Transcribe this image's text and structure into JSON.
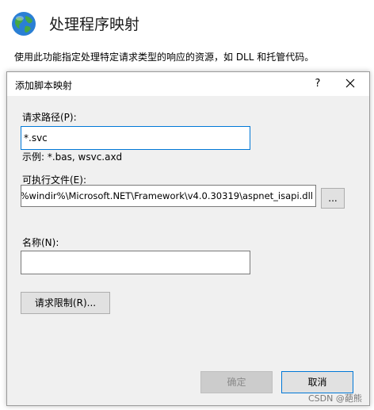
{
  "background": {
    "title": "处理程序映射",
    "description": "使用此功能指定处理特定请求类型的响应的资源，如 DLL 和托管代码。",
    "icon": "globe-icon"
  },
  "dialog": {
    "title": "添加脚本映射",
    "help_label": "?",
    "request_path": {
      "label": "请求路径(P):",
      "value": "*.svc",
      "example": "示例: *.bas, wsvc.axd"
    },
    "executable": {
      "label": "可执行文件(E):",
      "value": "%windir%\\Microsoft.NET\\Framework\\v4.0.30319\\aspnet_isapi.dll",
      "browse_label": "..."
    },
    "name": {
      "label": "名称(N):",
      "value": ""
    },
    "request_restrictions_label": "请求限制(R)...",
    "ok_label": "确定",
    "cancel_label": "取消"
  },
  "watermark": "CSDN @葩熊",
  "colors": {
    "focus_border": "#0078d7",
    "dialog_bg": "#f0f0f0"
  }
}
